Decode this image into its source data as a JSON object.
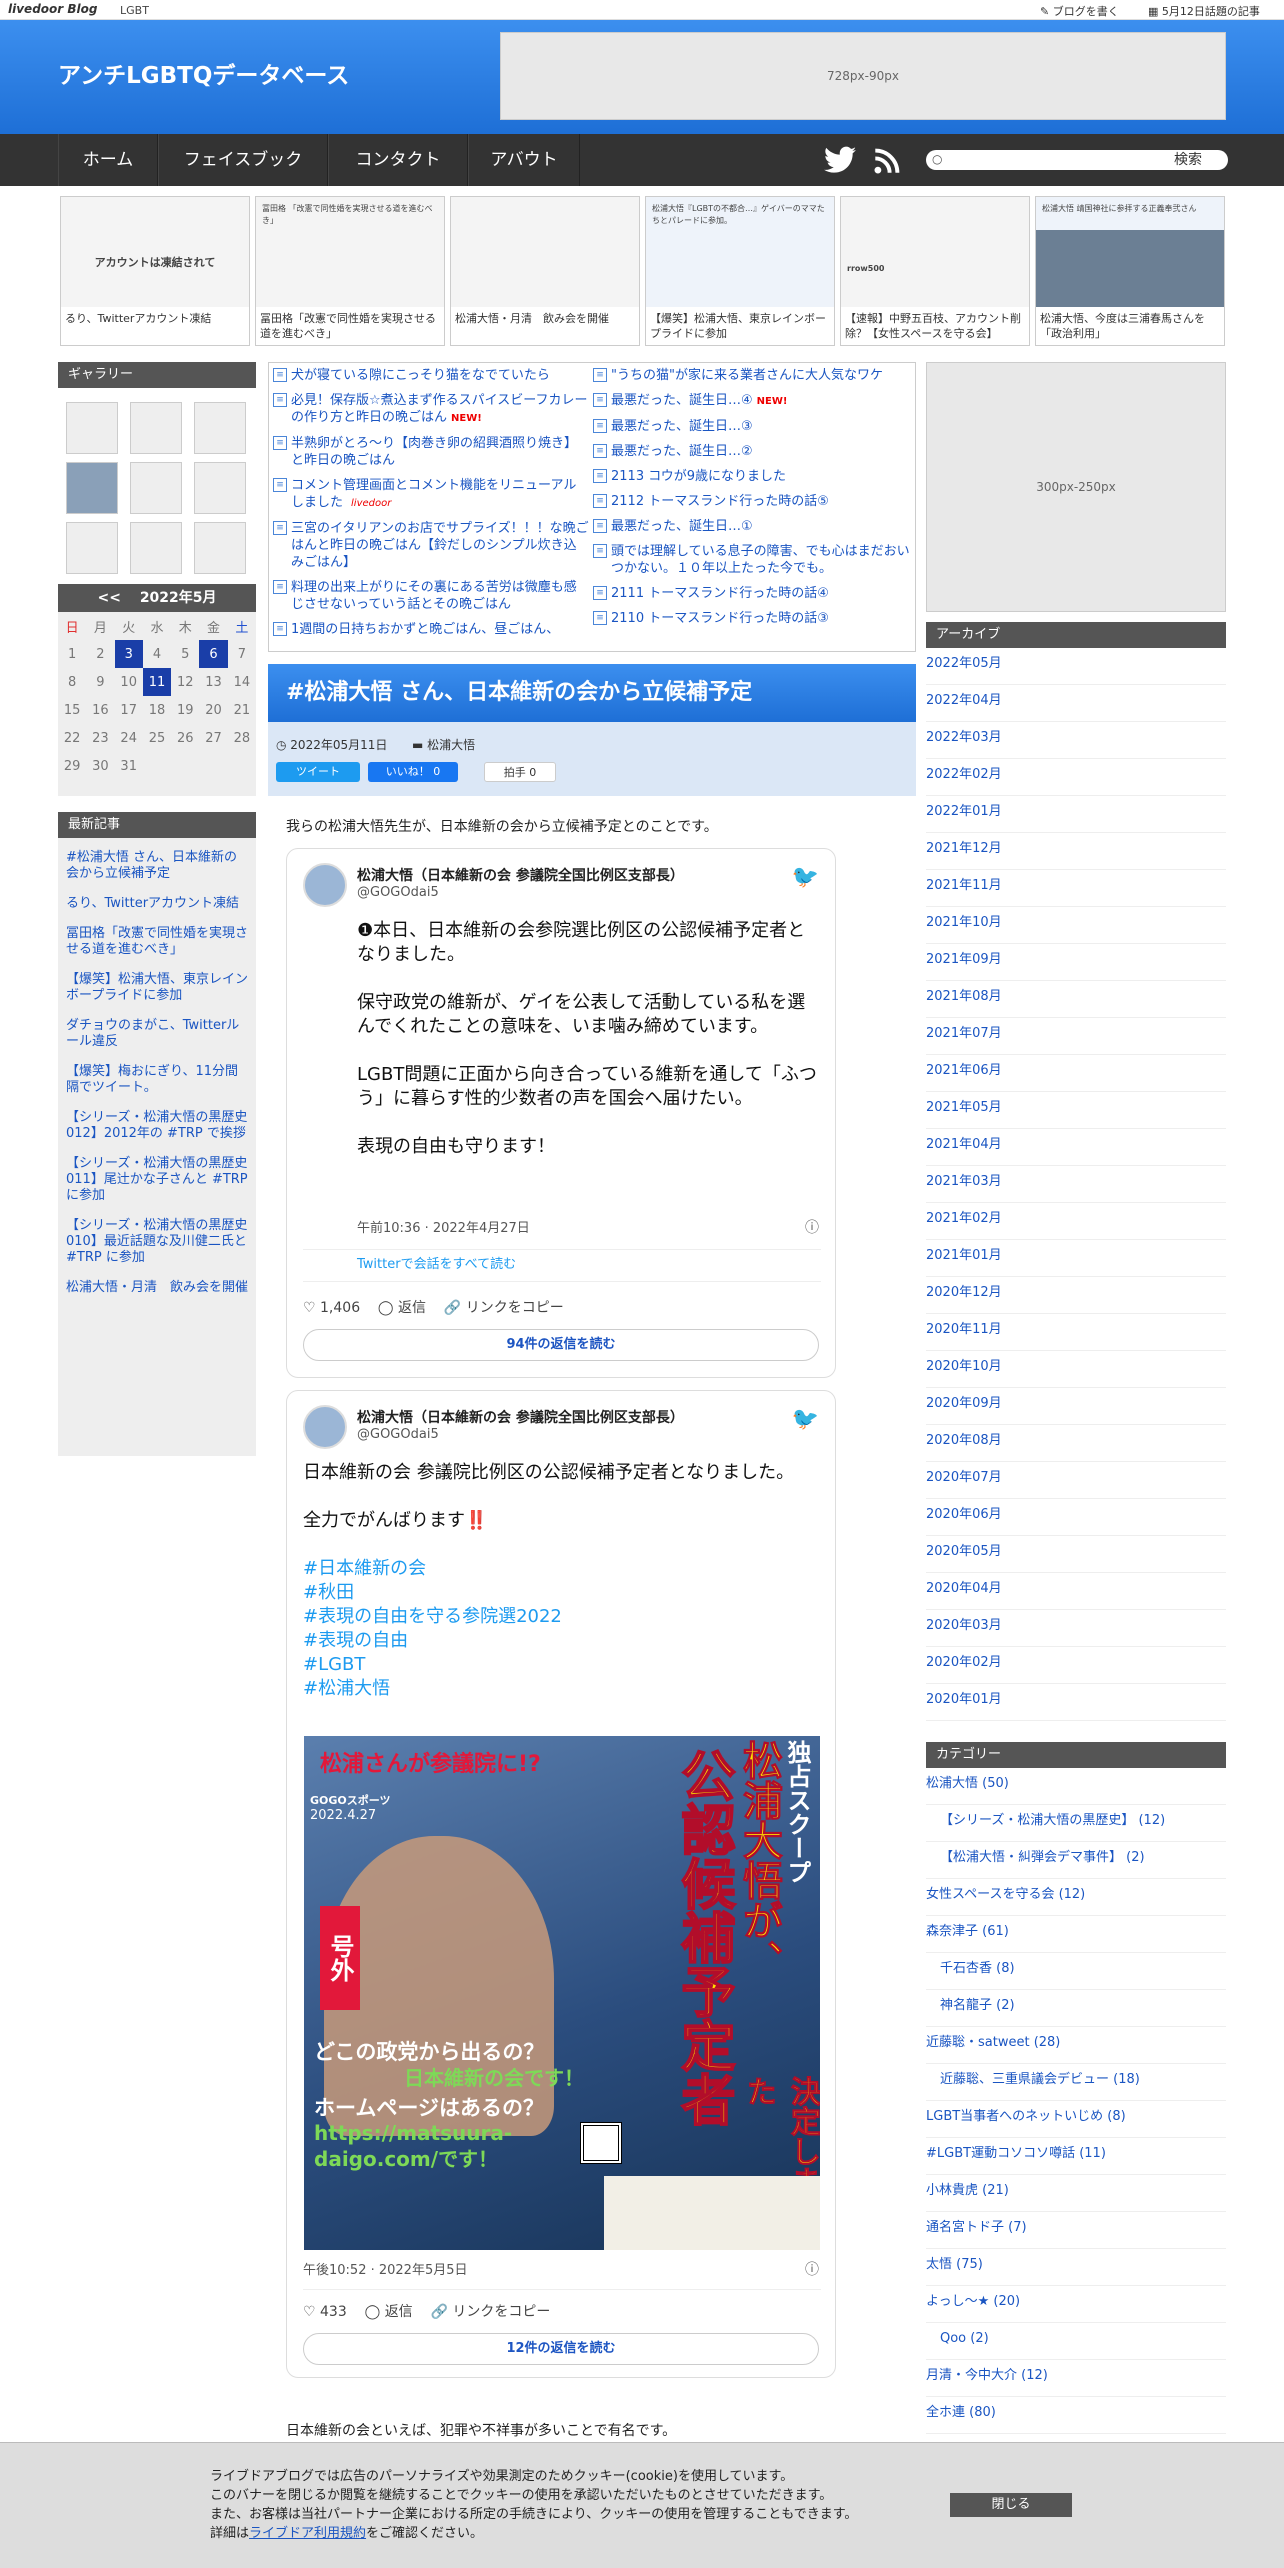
{
  "topbar": {
    "logo": "livedoor Blog",
    "category": "LGBT",
    "write": "ブログを書く",
    "today": "5月12日話題の記事"
  },
  "header": {
    "title": "アンチLGBTQデータベース",
    "ad": "728px-90px"
  },
  "nav": {
    "items": [
      "ホーム",
      "フェイスブック",
      "コンタクト",
      "アバウト"
    ],
    "search_btn": "検索",
    "search_placeholder": ""
  },
  "strip": [
    {
      "thumb": "アカウントは凍結されて",
      "cap": "るり、Twitterアカウント凍結"
    },
    {
      "thumb": "冨田格 「改憲で同性婚を実現させる道を進むべき」",
      "cap": "冨田格「改憲で同性婚を実現させる道を進むべき」"
    },
    {
      "thumb": "",
      "cap": "松浦大悟・月清　飲み会を開催"
    },
    {
      "thumb": "松浦大悟『LGBTの不都合…』ゲイバーのママたちとパレードに参加。",
      "cap": "【爆笑】松浦大悟、東京レインボープライドに参加"
    },
    {
      "thumb": "rrow500",
      "cap": "【速報】中野五百枝、アカウント削除？【女性スペースを守る会】"
    },
    {
      "thumb": "松浦大悟 靖国神社に参拝する正義奉弐さん",
      "cap": "松浦大悟、今度は三浦春馬さんを「政治利用」"
    }
  ],
  "sidebar": {
    "gallery_title": "ギャラリー",
    "calendar": {
      "prev": "<<",
      "month": "2022年5月",
      "days": [
        "日",
        "月",
        "火",
        "水",
        "木",
        "金",
        "土"
      ],
      "rows": [
        [
          "1",
          "2",
          "3",
          "4",
          "5",
          "6",
          "7"
        ],
        [
          "8",
          "9",
          "10",
          "11",
          "12",
          "13",
          "14"
        ],
        [
          "15",
          "16",
          "17",
          "18",
          "19",
          "20",
          "21"
        ],
        [
          "22",
          "23",
          "24",
          "25",
          "26",
          "27",
          "28"
        ],
        [
          "29",
          "30",
          "31",
          "",
          "",
          "",
          ""
        ]
      ]
    },
    "recent_title": "最新記事",
    "recent": [
      "#松浦大悟 さん、日本維新の会から立候補予定",
      "るり、Twitterアカウント凍結",
      "冨田格「改憲で同性婚を実現させる道を進むべき」",
      "【爆笑】松浦大悟、東京レインボープライドに参加",
      "ダチョウのまがこ、Twitterルール違反",
      "【爆笑】梅おにぎり、11分間隔でツイート。",
      "【シリーズ・松浦大悟の黒歴史012】2012年の #TRP で挨拶",
      "【シリーズ・松浦大悟の黒歴史011】尾辻かな子さんと #TRP に参加",
      "【シリーズ・松浦大悟の黒歴史010】最近話題な及川健二氏と #TRP に参加",
      "松浦大悟・月清　飲み会を開催"
    ]
  },
  "news": {
    "colA": [
      {
        "t": "犬が寝ている隙にこっそり猫をなでていたら",
        "new": false
      },
      {
        "t": "必見！保存版☆煮込まず作るスパイスビーフカレーの作り方と昨日の晩ごはん",
        "new": true
      },
      {
        "t": "半熟卵がとろ～り【肉巻き卵の紹興酒照り焼き】と昨日の晩ごはん",
        "new": false
      },
      {
        "t": "コメント管理画面とコメント機能をリニューアルしました",
        "new": false
      },
      {
        "t": "三宮のイタリアンのお店でサプライズ！！！な晩ごはんと昨日の晩ごはん【鈴だしのシンプル炊き込みごはん】",
        "new": false
      },
      {
        "t": "料理の出来上がりにその裏にある苦労は微塵も感じさせないっていう話とその晩ごはん",
        "new": false
      },
      {
        "t": "1週間の日持ちおかずと晩ごはん、昼ごはん、",
        "new": false
      }
    ],
    "colB": [
      {
        "t": "\"うちの猫\"が家に来る業者さんに大人気なワケ",
        "new": false
      },
      {
        "t": "最悪だった、誕生日…④",
        "new": true
      },
      {
        "t": "最悪だった、誕生日…③",
        "new": false
      },
      {
        "t": "最悪だった、誕生日…②",
        "new": false
      },
      {
        "t": "2113 コウが9歳になりました",
        "new": false
      },
      {
        "t": "2112 トーマスランド行った時の話⑤",
        "new": false
      },
      {
        "t": "最悪だった、誕生日…①",
        "new": false
      },
      {
        "t": "頭では理解している息子の障害、でも心はまだおいつかない。１０年以上たった今でも。",
        "new": false
      },
      {
        "t": "2111 トーマスランド行った時の話④",
        "new": false
      },
      {
        "t": "2110 トーマスランド行った時の話③",
        "new": false
      }
    ],
    "livedoor_tag": "livedoor"
  },
  "post": {
    "title": "#松浦大悟 さん、日本維新の会から立候補予定",
    "date": "2022年05月11日",
    "category": "松浦大悟",
    "tweet_btn": "ツイート",
    "like_btn": "いいね！ 0",
    "clap_btn": "拍手 0",
    "intro": "我らの松浦大悟先生が、日本維新の会から立候補予定とのことです。",
    "tweet1": {
      "name": "松浦大悟（日本維新の会 参議院全国比例区支部長）",
      "handle": "@GOGOdai5",
      "body": [
        "❶本日、日本維新の会参院選比例区の公認候補予定者となりました。",
        "",
        "保守政党の維新が、ゲイを公表して活動している私を選んでくれたことの意味を、いま噛み締めています。",
        "",
        "LGBT問題に正面から向き合っている維新を通して「ふつう」に暮らす性的少数者の声を国会へ届けたい。",
        "",
        "表現の自由も守ります！"
      ],
      "time": "午前10:36 · 2022年4月27日",
      "thread": "Twitterで会話をすべて読む",
      "likes": "1,406",
      "reply": "返信",
      "copy": "リンクをコピー",
      "more": "94件の返信を読む"
    },
    "tweet2": {
      "name": "松浦大悟（日本維新の会 参議院全国比例区支部長）",
      "handle": "@GOGOdai5",
      "body": [
        "日本維新の会 参議院比例区の公認候補予定者となりました。",
        "",
        "全力でがんばります‼️",
        "",
        "#日本維新の会",
        "#秋田",
        "#表現の自由を守る参院選2022",
        "#表現の自由",
        "#LGBT",
        "#松浦大悟"
      ],
      "time": "午後10:52 · 2022年5月5日",
      "likes": "433",
      "reply": "返信",
      "copy": "リンクをコピー",
      "more": "12件の返信を読む"
    },
    "promo": {
      "headline": "松浦さんが参議院に!?",
      "vertical1": "独占スクープ",
      "vertical2": "松浦大悟が、",
      "vertical3": "公認候補予定者",
      "paper": "GOGOスポーツ",
      "pdate": "2022.4.27",
      "extra": "号外",
      "q1": "どこの政党から出るの？",
      "a1": "日本維新の会です！",
      "q2": "ホームページはあるの？",
      "a2": "https://matsuura-daigo.com/です！",
      "stamp": "決定しました"
    },
    "footer": "日本維新の会といえば、犯罪や不祥事が多いことで有名です。"
  },
  "right": {
    "ad": "300px-250px",
    "archive_title": "アーカイブ",
    "archive": [
      "2022年05月",
      "2022年04月",
      "2022年03月",
      "2022年02月",
      "2022年01月",
      "2021年12月",
      "2021年11月",
      "2021年10月",
      "2021年09月",
      "2021年08月",
      "2021年07月",
      "2021年06月",
      "2021年05月",
      "2021年04月",
      "2021年03月",
      "2021年02月",
      "2021年01月",
      "2020年12月",
      "2020年11月",
      "2020年10月",
      "2020年09月",
      "2020年08月",
      "2020年07月",
      "2020年06月",
      "2020年05月",
      "2020年04月",
      "2020年03月",
      "2020年02月",
      "2020年01月"
    ],
    "cat_title": "カテゴリー",
    "cats": [
      {
        "t": "松浦大悟 (50)",
        "sub": false
      },
      {
        "t": "【シリーズ・松浦大悟の黒歴史】 (12)",
        "sub": true
      },
      {
        "t": "【松浦大悟・糾弾会デマ事件】 (2)",
        "sub": true
      },
      {
        "t": "女性スペースを守る会 (12)",
        "sub": false
      },
      {
        "t": "森奈津子 (61)",
        "sub": false
      },
      {
        "t": "千石杏香 (8)",
        "sub": true
      },
      {
        "t": "神名龍子 (2)",
        "sub": true
      },
      {
        "t": "近藤聡・satweet (28)",
        "sub": false
      },
      {
        "t": "近藤聡、三重県議会デビュー (18)",
        "sub": true
      },
      {
        "t": "LGBT当事者へのネットいじめ (8)",
        "sub": false
      },
      {
        "t": "#LGBT運動コソコソ噂話 (11)",
        "sub": false
      },
      {
        "t": "小林貴虎 (21)",
        "sub": false
      },
      {
        "t": "通名宮トド子 (7)",
        "sub": false
      },
      {
        "t": "太悟 (75)",
        "sub": false
      },
      {
        "t": "よっし～★ (20)",
        "sub": false
      },
      {
        "t": "Qoo (2)",
        "sub": true
      },
      {
        "t": "月清・今中大介 (12)",
        "sub": false
      },
      {
        "t": "全ホ連 (80)",
        "sub": false
      }
    ]
  },
  "cookie": {
    "lines": [
      "ライブドアブログでは広告のパーソナライズや効果測定のためクッキー(cookie)を使用しています。",
      "このバナーを閉じるか閲覧を継続することでクッキーの使用を承認いただいたものとさせていただきます。",
      "また、お客様は当社パートナー企業における所定の手続きにより、クッキーの使用を管理することもできます。",
      "詳細は"
    ],
    "link": "ライブドア利用規約",
    "tail": "をご確認ください。",
    "close": "閉じる"
  },
  "colors": {
    "brand": "#1e6fd6",
    "nav": "#333333",
    "accent": "#1a3ea8"
  }
}
